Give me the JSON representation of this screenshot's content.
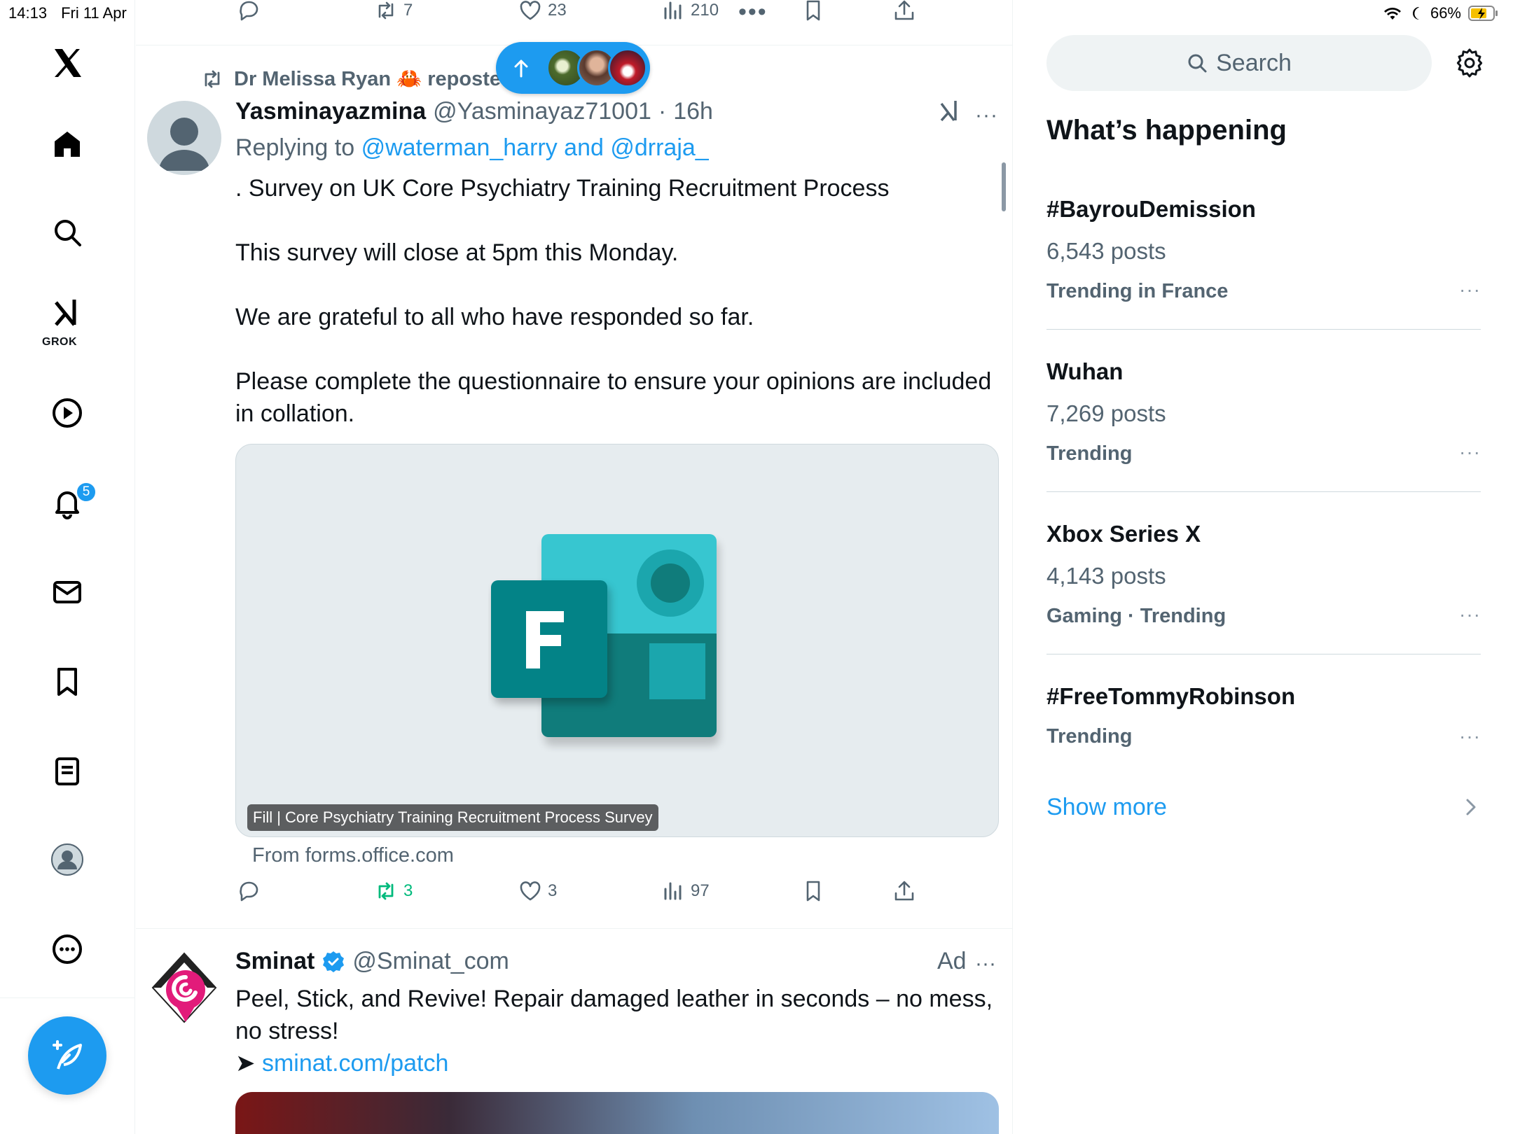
{
  "status_bar": {
    "time": "14:13",
    "date": "Fri 11 Apr",
    "battery": "66%"
  },
  "nav": {
    "items": [
      "X logo",
      "Home",
      "Explore",
      "Grok",
      "Video",
      "Notifications",
      "Messages",
      "Bookmarks",
      "Lists",
      "Profile",
      "More"
    ],
    "grok_label": "GROK",
    "notification_badge": "5",
    "compose_icon": "compose-feather-icon"
  },
  "prev_tweet_actions": {
    "reposts": "7",
    "likes": "23",
    "views": "210"
  },
  "tweet": {
    "repost_by": "Dr Melissa Ryan 🦀 reposted",
    "author_name": "Yasminayazmina",
    "author_handle": "@Yasminayaz71001",
    "separator": "·",
    "time": "16h",
    "replying_prefix": "Replying to",
    "replying_targets": "@waterman_harry and @drraja_",
    "paragraphs": [
      ". Survey on UK Core Psychiatry Training Recruitment Process",
      "This survey will close at 5pm this Monday.",
      "We are grateful to all who have responded so far.",
      "Please complete the questionnaire to ensure your opinions are included in collation."
    ],
    "card_caption": "Fill | Core Psychiatry Training Recruitment Process Survey",
    "card_source": "From forms.office.com",
    "more": "···",
    "actions": {
      "reposts": "3",
      "likes": "3",
      "views": "97"
    }
  },
  "ad": {
    "name": "Sminat",
    "handle": "@Sminat_com",
    "label": "Ad",
    "more": "···",
    "text": "Peel, Stick, and Revive! Repair damaged leather in seconds – no mess, no stress!",
    "arrow": "➤",
    "link": "sminat.com/patch"
  },
  "sidebar": {
    "search_placeholder": "Search",
    "heading": "What’s happening",
    "trends": [
      {
        "name": "#BayrouDemission",
        "posts": "6,543 posts",
        "context": "Trending in France"
      },
      {
        "name": "Wuhan",
        "posts": "7,269 posts",
        "context": "Trending"
      },
      {
        "name": "Xbox Series X",
        "posts": "4,143 posts",
        "context": "Gaming · Trending"
      },
      {
        "name": "#FreeTommyRobinson",
        "posts": "",
        "context": "Trending"
      }
    ],
    "trend_more": "···",
    "show_more": "Show more"
  },
  "colors": {
    "accent": "#1d9bf0",
    "repost_green": "#00ba7c",
    "muted": "#536471",
    "forms_teal": "#038387"
  }
}
